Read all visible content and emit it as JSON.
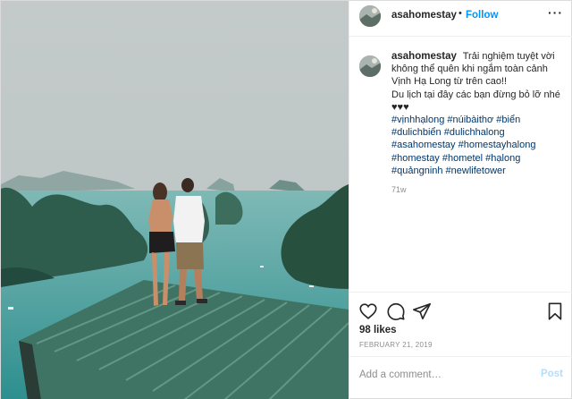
{
  "photo": {
    "description_icon": "photo",
    "colors": {
      "sky": "#c9cfcf",
      "water": "#3f9f9e",
      "karst": "#2f5a4c",
      "roof": "#4f7f6f"
    }
  },
  "header": {
    "username": "asahomestay",
    "separator": "•",
    "follow_label": "Follow",
    "more_icon": "more-dots-icon",
    "more_label": "···"
  },
  "caption": {
    "username": "asahomestay",
    "text_line1": "Trải nghiệm tuyệt vời không thể quên khi ngắm toàn cảnh Vịnh Hạ Long từ trên cao!!",
    "text_line2": "Du lịch tại đây các bạn đừng bỏ lỡ nhé ♥♥♥",
    "hashtags": "#vịnhhạlong #núibàithơ #biển #dulichbiển #dulichhalong #asahomestay #homestayhalong #homestay #hometel #hạlong #quảngninh #newlifetower",
    "time_ago": "71w"
  },
  "actions": {
    "icons": [
      "heart-icon",
      "comment-icon",
      "share-icon",
      "bookmark-icon"
    ],
    "likes": "98 likes",
    "date": "FEBRUARY 21, 2019"
  },
  "add_comment": {
    "placeholder": "Add a comment…",
    "post_label": "Post"
  },
  "colors": {
    "accent": "#0095f6",
    "post_disabled": "#b2dffc",
    "hashtag": "#00376b",
    "muted": "#8e8e8e"
  }
}
